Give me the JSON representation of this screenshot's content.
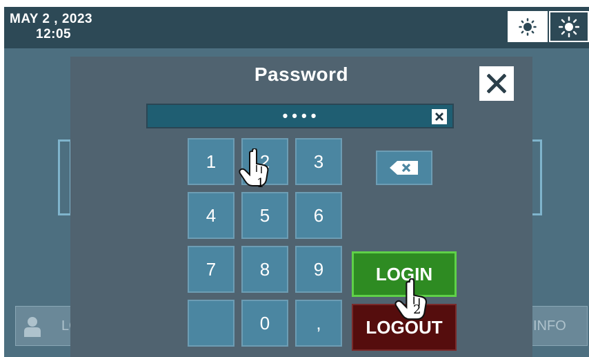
{
  "header": {
    "date": "MAY  2 , 2023",
    "time": "12:05",
    "brightness_low_icon": "sun-dim-icon",
    "brightness_high_icon": "sun-bright-icon"
  },
  "footer": {
    "user_icon": "user-icon",
    "login_label": "LO",
    "info_label": "INFO"
  },
  "modal": {
    "title": "Password",
    "close_icon": "close-icon",
    "password_mask": "••••",
    "clear_icon": "clear-x-icon",
    "keys": [
      "1",
      "2",
      "3",
      "4",
      "5",
      "6",
      "7",
      "8",
      "9",
      "",
      "0",
      ","
    ],
    "backspace_icon": "backspace-icon",
    "login_label": "LOGIN",
    "logout_label": "LOGOUT"
  },
  "annotations": {
    "step_1": "1",
    "step_2": "2",
    "cursor_icon": "hand-pointer-icon"
  },
  "colors": {
    "topbar": "#2d4956",
    "modal": "#506370",
    "key": "#4b86a1",
    "login": "#2e8b22",
    "logout": "#550d0d"
  }
}
